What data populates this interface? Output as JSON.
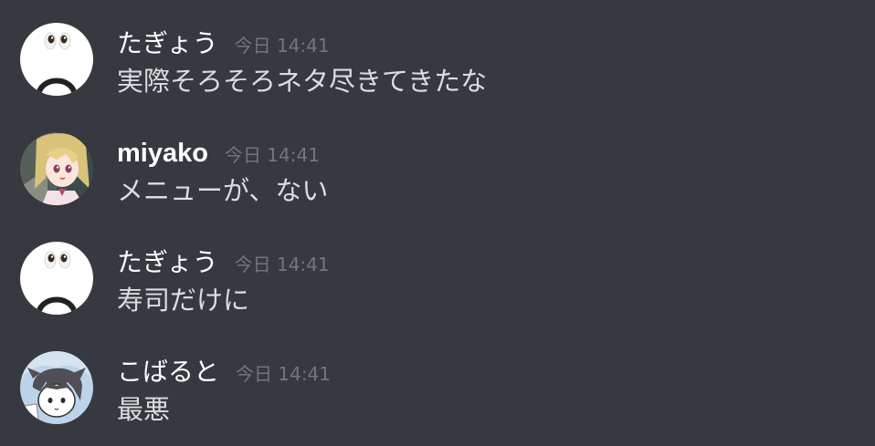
{
  "messages": [
    {
      "username": "たぎょう",
      "timestamp": "今日 14:41",
      "text": "実際そろそろネタ尽きてきたな",
      "avatar_icon": "white-face-avatar-icon"
    },
    {
      "username": "miyako",
      "timestamp": "今日 14:41",
      "text": "メニューが、ない",
      "avatar_icon": "anime-girl-avatar-icon"
    },
    {
      "username": "たぎょう",
      "timestamp": "今日 14:41",
      "text": "寿司だけに",
      "avatar_icon": "white-face-avatar-icon"
    },
    {
      "username": "こばると",
      "timestamp": "今日 14:41",
      "text": "最悪",
      "avatar_icon": "gray-hair-boy-avatar-icon"
    }
  ],
  "colors": {
    "background": "#36393f",
    "username": "#ffffff",
    "message_text": "#dcddde",
    "timestamp": "#72767d"
  }
}
